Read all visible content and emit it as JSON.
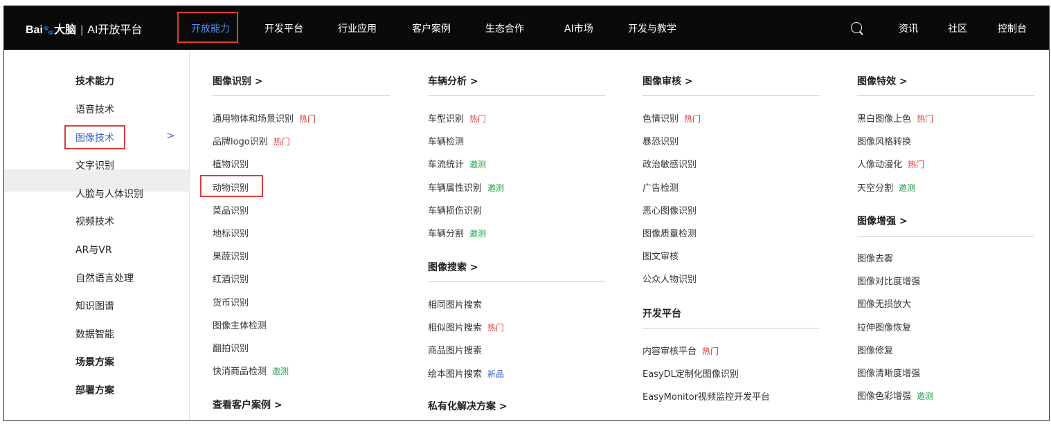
{
  "header": {
    "logo_text": "Bai",
    "logo_paw": "🐾",
    "logo_suffix": "大脑",
    "separator": "|",
    "title": "AI开放平台",
    "nav": [
      "开放能力",
      "开发平台",
      "行业应用",
      "客户案例",
      "生态合作",
      "AI市场",
      "开发与教学"
    ],
    "right": [
      "资讯",
      "社区",
      "控制台"
    ],
    "search_icon": "search-icon"
  },
  "sidebar": {
    "items": [
      "技术能力",
      "语音技术",
      "图像技术",
      "文字识别",
      "人脸与人体识别",
      "视频技术",
      "AR与VR",
      "自然语言处理",
      "知识图谱",
      "数据智能",
      "场景方案",
      "部署方案"
    ],
    "active_chevron": ">"
  },
  "columns": {
    "c1": {
      "title": "图像识别 >",
      "items": [
        {
          "label": "通用物体和场景识别",
          "badge": "热门"
        },
        {
          "label": "品牌logo识别",
          "badge": "热门"
        },
        {
          "label": "植物识别",
          "badge": ""
        },
        {
          "label": "动物识别",
          "badge": ""
        },
        {
          "label": "菜品识别",
          "badge": ""
        },
        {
          "label": "地标识别",
          "badge": ""
        },
        {
          "label": "果蔬识别",
          "badge": ""
        },
        {
          "label": "红酒识别",
          "badge": ""
        },
        {
          "label": "货币识别",
          "badge": ""
        },
        {
          "label": "图像主体检测",
          "badge": ""
        },
        {
          "label": "翻拍识别",
          "badge": ""
        },
        {
          "label": "快消商品检测",
          "badge": "邀测"
        }
      ],
      "footer": "查看客户案例 >"
    },
    "c2": {
      "title": "车辆分析 >",
      "items": [
        {
          "label": "车型识别",
          "badge": "热门"
        },
        {
          "label": "车辆检测",
          "badge": ""
        },
        {
          "label": "车流统计",
          "badge": "邀测"
        },
        {
          "label": "车辆属性识别",
          "badge": "邀测"
        },
        {
          "label": "车辆损伤识别",
          "badge": ""
        },
        {
          "label": "车辆分割",
          "badge": "邀测"
        }
      ],
      "title2": "图像搜索 >",
      "items2": [
        {
          "label": "相同图片搜索",
          "badge": ""
        },
        {
          "label": "相似图片搜索",
          "badge": "热门"
        },
        {
          "label": "商品图片搜索",
          "badge": ""
        },
        {
          "label": "绘本图片搜索",
          "badge": "新品"
        }
      ],
      "footer": "私有化解决方案 >"
    },
    "c3": {
      "title": "图像审核 >",
      "items": [
        {
          "label": "色情识别",
          "badge": "热门"
        },
        {
          "label": "暴恐识别",
          "badge": ""
        },
        {
          "label": "政治敏感识别",
          "badge": ""
        },
        {
          "label": "广告检测",
          "badge": ""
        },
        {
          "label": "恶心图像识别",
          "badge": ""
        },
        {
          "label": "图像质量检测",
          "badge": ""
        },
        {
          "label": "图文审核",
          "badge": ""
        },
        {
          "label": "公众人物识别",
          "badge": ""
        }
      ],
      "title2": "开发平台",
      "items2": [
        {
          "label": "内容审核平台",
          "badge": "热门"
        },
        {
          "label": "EasyDL定制化图像识别",
          "badge": ""
        },
        {
          "label": "EasyMonitor视频监控开发平台",
          "badge": ""
        }
      ]
    },
    "c4": {
      "title": "图像特效 >",
      "items": [
        {
          "label": "黑白图像上色",
          "badge": "热门"
        },
        {
          "label": "图像风格转换",
          "badge": ""
        },
        {
          "label": "人像动漫化",
          "badge": "热门"
        },
        {
          "label": "天空分割",
          "badge": "邀测"
        }
      ],
      "title2": "图像增强 >",
      "items2": [
        {
          "label": "图像去雾",
          "badge": ""
        },
        {
          "label": "图像对比度增强",
          "badge": ""
        },
        {
          "label": "图像无损放大",
          "badge": ""
        },
        {
          "label": "拉伸图像恢复",
          "badge": ""
        },
        {
          "label": "图像修复",
          "badge": ""
        },
        {
          "label": "图像清晰度增强",
          "badge": ""
        },
        {
          "label": "图像色彩增强",
          "badge": "邀测"
        }
      ]
    }
  },
  "colors": {
    "hot": "#e03a3a",
    "beta": "#1aa34a",
    "new": "#3a63c8",
    "accent": "#4e8cf7",
    "highlight_box": "#e03a3a"
  }
}
